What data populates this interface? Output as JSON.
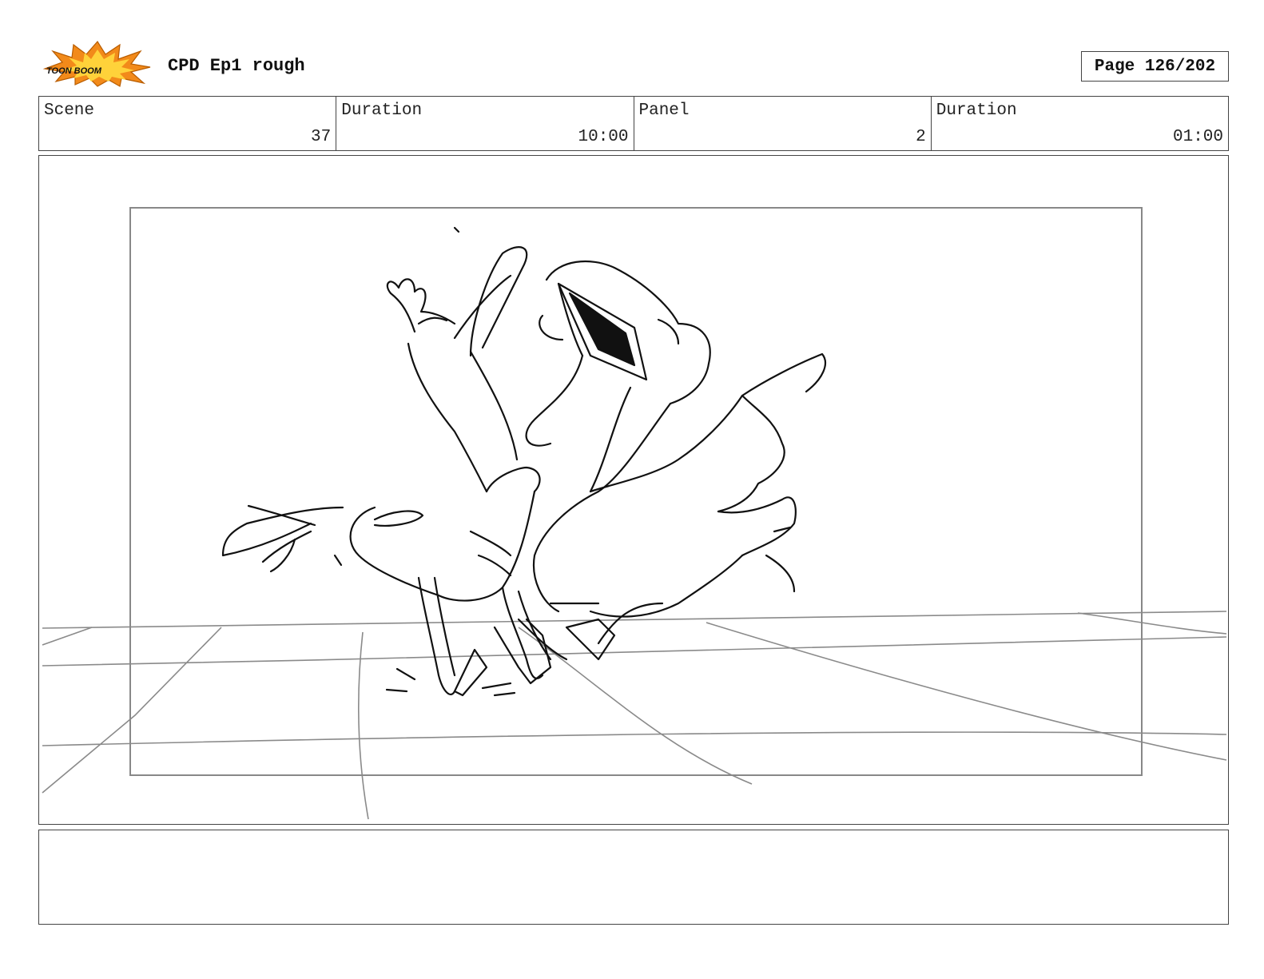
{
  "header": {
    "logo_text": "TOON BOOM",
    "title": "CPD Ep1 rough",
    "page_label": "Page 126/202"
  },
  "info": [
    {
      "label": "Scene",
      "value": "37"
    },
    {
      "label": "Duration",
      "value": "10:00"
    },
    {
      "label": "Panel",
      "value": "2"
    },
    {
      "label": "Duration",
      "value": "01:00"
    }
  ],
  "panel": {
    "drawing": "rough sketch of a duck character"
  },
  "notes": {
    "text": ""
  },
  "colors": {
    "border": "#444444",
    "sketch": "#111111",
    "guide": "#8a8a8a",
    "logo_orange": "#f28a1a",
    "logo_yellow": "#ffd23a"
  }
}
